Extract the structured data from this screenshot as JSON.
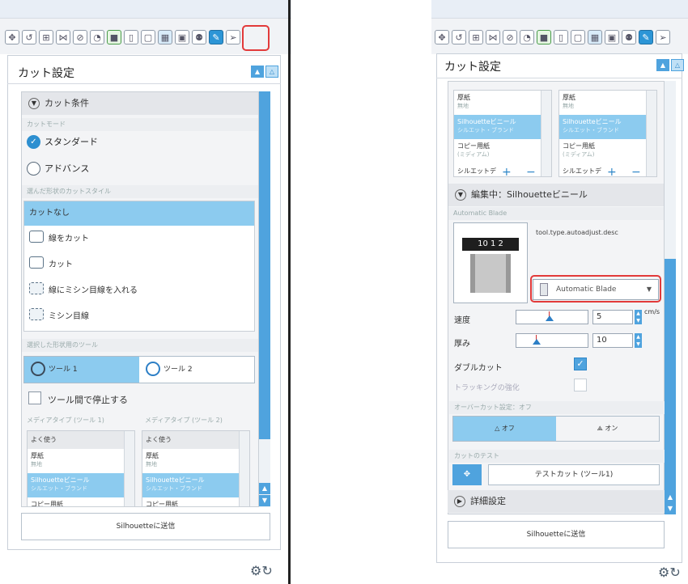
{
  "left": {
    "title": "カット設定",
    "cut_conditions_header": "カット条件",
    "cut_mode_label": "カットモード",
    "mode_standard": "スタンダード",
    "mode_advanced": "アドバンス",
    "style_section_label": "選んだ形状のカットスタイル",
    "styles": [
      "カットなし",
      "線をカット",
      "カット",
      "線にミシン目線を入れる",
      "ミシン目線"
    ],
    "tool_section_label": "選択した形状用のツール",
    "tool1": "ツール 1",
    "tool2": "ツール 2",
    "stop_between_tools": "ツール間で停止する",
    "media_type_tool1": "メディアタイプ (ツール 1)",
    "media_type_tool2": "メディアタイプ (ツール 2)",
    "media_items": [
      {
        "name": "よく使う",
        "sub": ""
      },
      {
        "name": "厚紙",
        "sub": "無地"
      },
      {
        "name": "Silhouetteビニール",
        "sub": "シルエット・ブランド"
      },
      {
        "name": "コピー用紙",
        "sub": ""
      }
    ],
    "send_button": "Silhouetteに送信"
  },
  "right": {
    "title": "カット設定",
    "media_items": [
      {
        "name": "厚紙",
        "sub": "無地"
      },
      {
        "name": "Silhouetteビニール",
        "sub": "シルエット・ブランド"
      },
      {
        "name": "コピー用紙",
        "sub": "(ミディアム)"
      },
      {
        "name": "シルエットデ",
        "sub": ""
      }
    ],
    "plus": "+",
    "minus": "−",
    "editing_header": "編集中：Silhouetteビニール",
    "blade_section": "Automatic Blade",
    "blade_desc": "tool.type.autoadjust.desc",
    "blade_digits": "10 1 2",
    "blade_select": "Automatic Blade",
    "speed_label": "速度",
    "speed_value": "5",
    "speed_unit": "cm/s",
    "thickness_label": "厚み",
    "thickness_value": "10",
    "double_cut": "ダブルカット",
    "tracking": "トラッキングの強化",
    "overcut_section": "オーバーカット設定：オフ",
    "overcut_off": "オフ",
    "overcut_on": "オン",
    "test_section": "カットのテスト",
    "test_button": "テストカット (ツール1)",
    "advanced_header": "詳細設定",
    "send_button": "Silhouetteに送信"
  }
}
